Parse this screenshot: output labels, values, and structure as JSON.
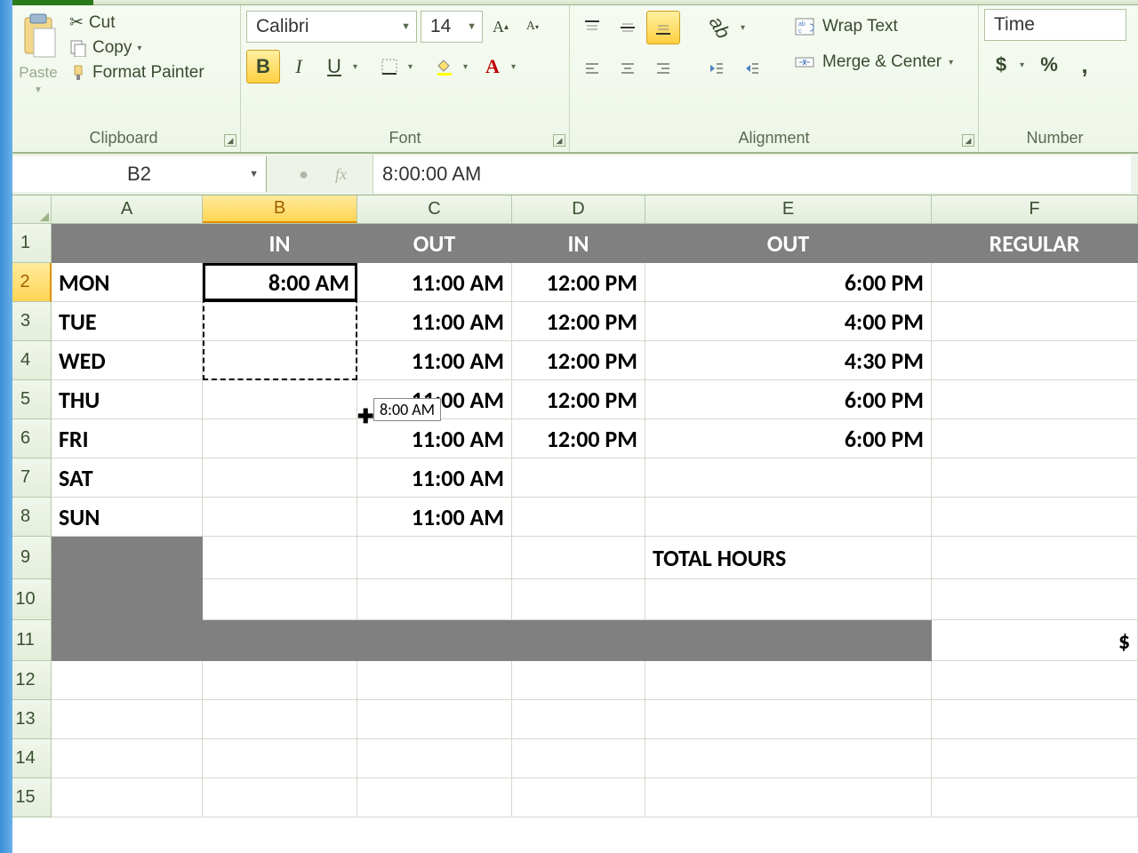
{
  "ribbon": {
    "clipboard": {
      "paste": "Paste",
      "cut": "Cut",
      "copy": "Copy",
      "format_painter": "Format Painter",
      "label": "Clipboard"
    },
    "font": {
      "name": "Calibri",
      "size": "14",
      "label": "Font"
    },
    "alignment": {
      "wrap": "Wrap Text",
      "merge": "Merge & Center",
      "label": "Alignment"
    },
    "number": {
      "format": "Time",
      "label": "Number"
    }
  },
  "formula_bar": {
    "name_box": "B2",
    "formula": "8:00:00 AM"
  },
  "columns": [
    "A",
    "B",
    "C",
    "D",
    "E",
    "F"
  ],
  "row_headers": [
    "1",
    "2",
    "3",
    "4",
    "5",
    "6",
    "7",
    "8",
    "9",
    "10",
    "11",
    "12",
    "13",
    "14",
    "15"
  ],
  "table": {
    "headers": {
      "B": "IN",
      "C": "OUT",
      "D": "IN",
      "E": "OUT",
      "F": "REGULAR"
    },
    "rows": [
      {
        "A": "MON",
        "B": "8:00 AM",
        "C": "11:00 AM",
        "D": "12:00 PM",
        "E": "6:00 PM"
      },
      {
        "A": "TUE",
        "B": "",
        "C": "11:00 AM",
        "D": "12:00 PM",
        "E": "4:00 PM"
      },
      {
        "A": "WED",
        "B": "",
        "C": "11:00 AM",
        "D": "12:00 PM",
        "E": "4:30 PM"
      },
      {
        "A": "THU",
        "B": "",
        "C": "11:00 AM",
        "D": "12:00 PM",
        "E": "6:00 PM"
      },
      {
        "A": "FRI",
        "B": "",
        "C": "11:00 AM",
        "D": "12:00 PM",
        "E": "6:00 PM"
      },
      {
        "A": "SAT",
        "B": "",
        "C": "11:00 AM",
        "D": "",
        "E": ""
      },
      {
        "A": "SUN",
        "B": "",
        "C": "11:00 AM",
        "D": "",
        "E": ""
      }
    ],
    "total_label": "TOTAL HOURS",
    "f11": "$"
  },
  "drag_tooltip": "8:00 AM"
}
